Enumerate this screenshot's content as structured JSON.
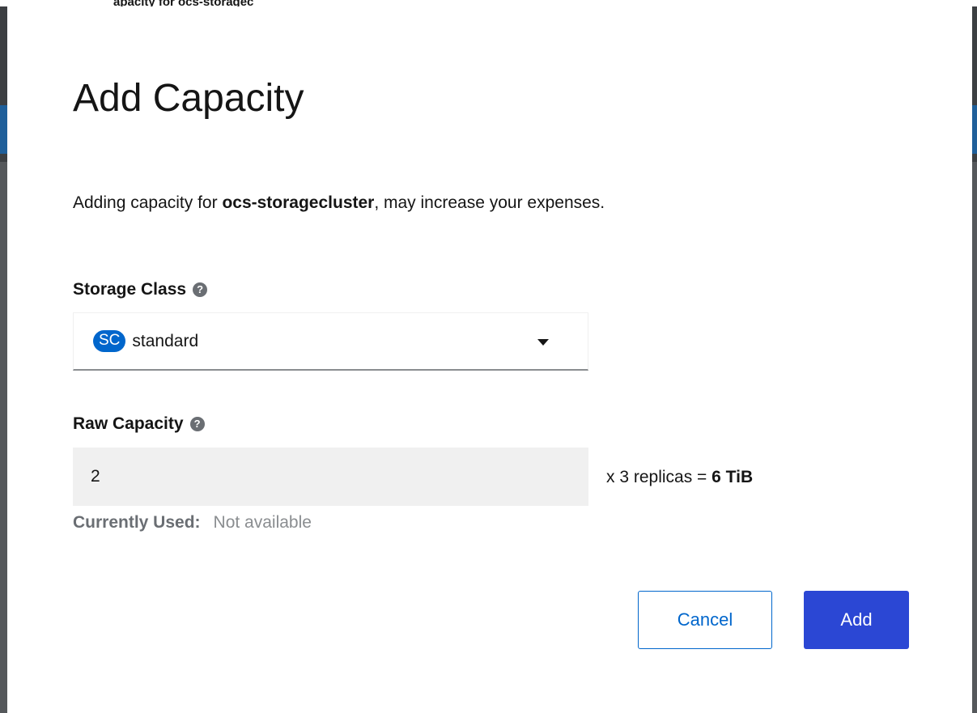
{
  "background": {
    "top_text": "apacity for ocs-storagec"
  },
  "modal": {
    "title": "Add Capacity",
    "description": {
      "prefix": "Adding capacity for ",
      "cluster": "ocs-storagecluster",
      "suffix": ", may increase your expenses."
    },
    "storage_class": {
      "label": "Storage Class",
      "badge": "SC",
      "value": "standard"
    },
    "raw_capacity": {
      "label": "Raw Capacity",
      "value": "2",
      "replicas_prefix": "x 3 replicas = ",
      "replicas_total": "6 TiB"
    },
    "currently_used": {
      "label": "Currently Used:",
      "value": "Not available"
    },
    "buttons": {
      "cancel": "Cancel",
      "add": "Add"
    }
  },
  "colors": {
    "primary": "#2b47d4",
    "link": "#0066cc",
    "badge": "#0066cc"
  }
}
